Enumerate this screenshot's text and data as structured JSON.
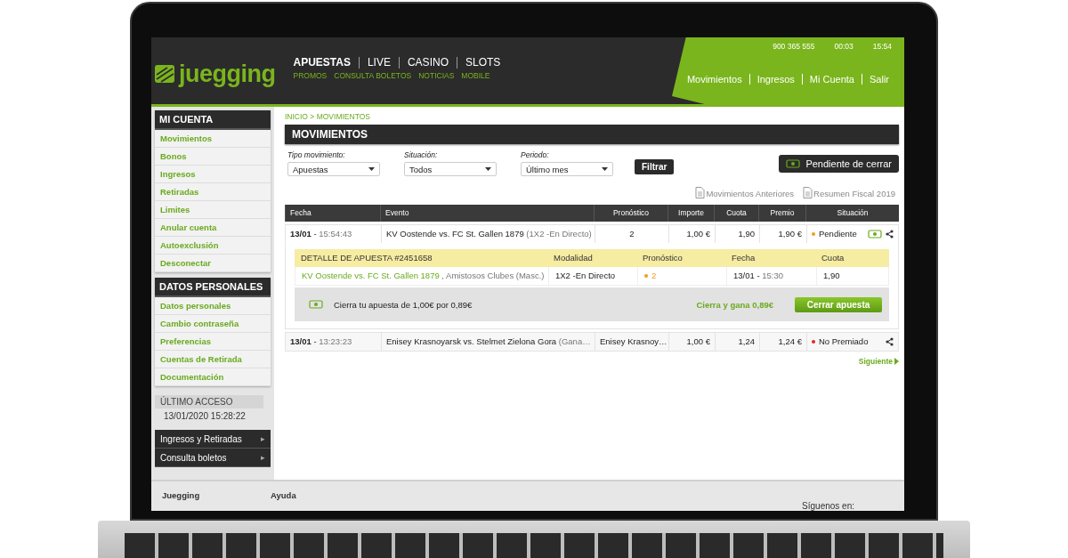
{
  "header": {
    "logo": "juegging",
    "nav": [
      {
        "label": "APUESTAS",
        "selected": true
      },
      {
        "label": "LIVE",
        "selected": false
      },
      {
        "label": "CASINO",
        "selected": false
      },
      {
        "label": "SLOTS",
        "selected": false
      }
    ],
    "subnav": [
      "PROMOS",
      "CONSULTA BOLETOS",
      "NOTICIAS",
      "MOBILE"
    ],
    "info": [
      "900 365 555",
      "00:03",
      "15:54"
    ],
    "account_links": [
      "Movimientos",
      "Ingresos",
      "Mi Cuenta",
      "Salir"
    ]
  },
  "sidebar": {
    "sections": [
      {
        "title": "MI CUENTA",
        "items": [
          "Movimientos",
          "Bonos",
          "Ingresos",
          "Retiradas",
          "Limites",
          "Anular cuenta",
          "Autoexclusión",
          "Desconectar"
        ]
      },
      {
        "title": "DATOS PERSONALES",
        "items": [
          "Datos personales",
          "Cambio contraseña",
          "Preferencias",
          "Cuentas de Retirada",
          "Documentación"
        ]
      }
    ],
    "last_access": {
      "label": "ÚLTIMO ACCESO",
      "value": "13/01/2020 15:28:22"
    },
    "menu": [
      "Ingresos y Retiradas",
      "Consulta boletos"
    ],
    "menu_arrow": "▸"
  },
  "breadcrumb": "INICIO > MOVIMIENTOS",
  "title": "MOVIMIENTOS",
  "filters": [
    {
      "label": "Tipo movimiento:",
      "value": "Apuestas"
    },
    {
      "label": "Situación:",
      "value": "Todos"
    },
    {
      "label": "Periodo:",
      "value": "Último mes"
    }
  ],
  "filter_button": "Filtrar",
  "pending_button": "Pendiente de cerrar",
  "doc_links": [
    "Movimientos Anteriores",
    "Resumen Fiscal 2019"
  ],
  "table": {
    "columns": [
      "Fecha",
      "Evento",
      "Pronóstico",
      "Importe",
      "Cuota",
      "Premio",
      "Situación"
    ],
    "rows": [
      {
        "date": "13/01",
        "sep": "-",
        "time": "15:54:43",
        "event": "KV Oostende vs. FC St. Gallen 1879",
        "market": "(1X2 -En Directo)",
        "pick": "2",
        "stake": "1,00 €",
        "odds": "1,90",
        "prize": "1,90 €",
        "status": "Pendiente",
        "color": "#f39c1f",
        "cashout": true,
        "expanded": true,
        "detail": {
          "columns": [
            "DETALLE DE APUESTA #2451658",
            "Modalidad",
            "Pronóstico",
            "Fecha",
            "Cuota"
          ],
          "event": "KV Oostende vs. FC St. Gallen 1879",
          "competition": ", Amistosos Clubes (Masc.)",
          "mode": "1X2 -En Directo",
          "pick": "2",
          "date": "13/01",
          "sep": "-",
          "time": "15:30",
          "odds": "1,90",
          "offer": "Cierra tu apuesta de 1,00€ por 0,89€",
          "gain": "Cierra y gana 0,89€",
          "button": "Cerrar apuesta"
        }
      },
      {
        "date": "13/01",
        "sep": "-",
        "time": "13:23:23",
        "event": "Enisey Krasnoyarsk vs. Stelmet Zielona Gora",
        "market": "(Gana…",
        "pick": "Enisey Krasnoy…",
        "stake": "1,00 €",
        "odds": "1,24",
        "prize": "1,24 €",
        "status": "No Premiado",
        "color": "#e0262e",
        "cashout": false,
        "expanded": false
      }
    ]
  },
  "next": "Siguiente",
  "footer": {
    "links": [
      "Juegging",
      "Ayuda"
    ],
    "follow": "Síguenos en:"
  }
}
